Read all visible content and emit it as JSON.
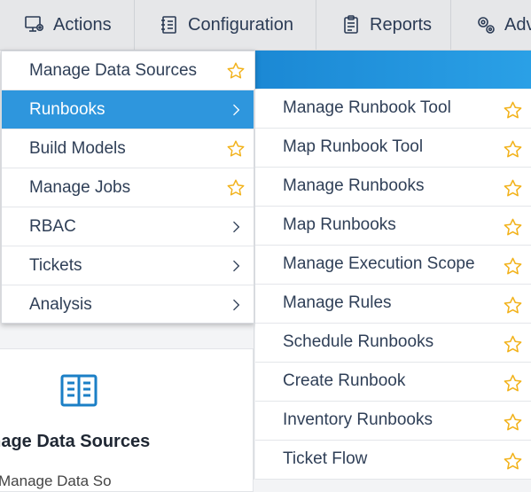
{
  "topnav": {
    "tabs": [
      {
        "label": "Actions",
        "icon": "monitor-gear-icon"
      },
      {
        "label": "Configuration",
        "icon": "notebook-icon"
      },
      {
        "label": "Reports",
        "icon": "clipboard-icon"
      },
      {
        "label": "Adv",
        "icon": "cogs-icon"
      }
    ]
  },
  "menu": {
    "items": [
      {
        "label": "Manage Data Sources",
        "trailing": "star"
      },
      {
        "label": "Runbooks",
        "trailing": "chevron",
        "active": true
      },
      {
        "label": "Build Models",
        "trailing": "star"
      },
      {
        "label": "Manage Jobs",
        "trailing": "star"
      },
      {
        "label": "RBAC",
        "trailing": "chevron"
      },
      {
        "label": "Tickets",
        "trailing": "chevron"
      },
      {
        "label": "Analysis",
        "trailing": "chevron"
      }
    ]
  },
  "submenu": {
    "items": [
      {
        "label": "Manage Runbook Tool"
      },
      {
        "label": "Map Runbook Tool"
      },
      {
        "label": "Manage Runbooks"
      },
      {
        "label": "Map Runbooks"
      },
      {
        "label": "Manage Execution Scope"
      },
      {
        "label": "Manage Rules"
      },
      {
        "label": "Schedule Runbooks"
      },
      {
        "label": "Create Runbook"
      },
      {
        "label": "Inventory Runbooks"
      },
      {
        "label": "Ticket Flow"
      }
    ]
  },
  "card": {
    "title": "anage Data Sources",
    "subtitle": "Manage Data So",
    "icon": "book-icon"
  },
  "colors": {
    "accent": "#2e96dd",
    "star": "#f2b21b",
    "icon_blue": "#1b7fc6"
  }
}
